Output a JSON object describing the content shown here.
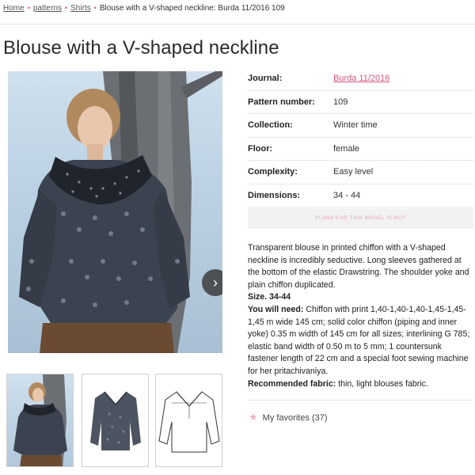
{
  "breadcrumb": {
    "home": "Home",
    "sep": "•",
    "patterns": "patterns",
    "shirts": "Shirts",
    "current": "Blouse with a V-shaped neckline: Burda 11/2016 109"
  },
  "title": "Blouse with a V-shaped neckline",
  "details": [
    {
      "label": "Journal:",
      "value": "Burda 11/2016"
    },
    {
      "label": "Pattern number:",
      "value": "109"
    },
    {
      "label": "Collection:",
      "value": "Winter time"
    },
    {
      "label": "Floor:",
      "value": "female"
    },
    {
      "label": "Complexity:",
      "value": "Easy level"
    },
    {
      "label": "Dimensions:",
      "value": "34 - 44"
    }
  ],
  "plans_note": "PLANS FOR THIS MODEL IS NOT",
  "description": {
    "intro": "Transparent blouse in printed chiffon with a V-shaped neckline is incredibly seductive. Long sleeves gathered at the bottom of the elastic Drawstring. The shoulder yoke and plain chiffon duplicated.",
    "size": "Size. 34-44",
    "need_label": "You will need:",
    "need_text": " Chiffon with print 1,40-1,40-1,40-1,45-1,45-1,45 m wide 145 cm; solid color chiffon (piping and inner yoke) 0.35 m width of 145 cm for all sizes; interlining G 785; elastic band width of 0.50 m to 5 mm; 1 countersunk fastener length of 22 cm and a special foot sewing machine for her pritachivaniya.",
    "fabric_label": "Recommended fabric:",
    "fabric_text": " thin, light blouses fabric."
  },
  "favorites": {
    "icon": "star-icon",
    "label": "My favorites (37)"
  },
  "icons": {
    "next": "›",
    "star": "★"
  },
  "colors": {
    "accent": "#d9557a"
  }
}
